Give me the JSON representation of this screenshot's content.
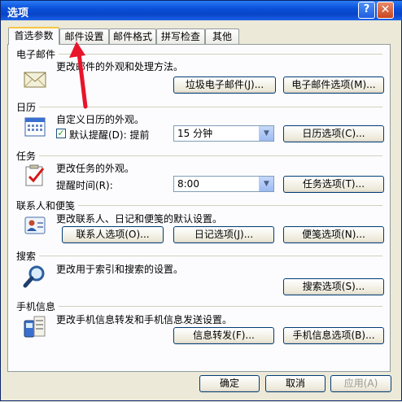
{
  "window": {
    "title": "选项",
    "help_label": "?",
    "close_label": "✕"
  },
  "tabs": [
    {
      "label": "首选参数"
    },
    {
      "label": "邮件设置"
    },
    {
      "label": "邮件格式"
    },
    {
      "label": "拼写检查"
    },
    {
      "label": "其他"
    }
  ],
  "email": {
    "heading": "电子邮件",
    "description": "更改邮件的外观和处理方法。",
    "junk_button": "垃圾电子邮件(J)...",
    "options_button": "电子邮件选项(M)...",
    "icon": "envelope-icon"
  },
  "calendar": {
    "heading": "日历",
    "description": "自定义日历的外观。",
    "reminder_checkbox_label": "默认提醒(D): 提前",
    "reminder_checked": true,
    "reminder_value": "15 分钟",
    "options_button": "日历选项(C)...",
    "icon": "calendar-icon"
  },
  "tasks": {
    "heading": "任务",
    "description": "更改任务的外观。",
    "reminder_time_label": "提醒时间(R):",
    "reminder_time_value": "8:00",
    "options_button": "任务选项(T)...",
    "icon": "task-check-icon"
  },
  "contacts": {
    "heading": "联系人和便笺",
    "description": "更改联系人、日记和便笺的默认设置。",
    "contact_button": "联系人选项(O)...",
    "journal_button": "日记选项(J)...",
    "notes_button": "便笺选项(N)...",
    "icon": "contact-card-icon"
  },
  "search": {
    "heading": "搜索",
    "description": "更改用于索引和搜索的设置。",
    "options_button": "搜索选项(S)...",
    "icon": "magnifier-icon"
  },
  "mobile": {
    "heading": "手机信息",
    "description": "更改手机信息转发和手机信息发送设置。",
    "forward_button": "信息转发(F)...",
    "options_button": "手机信息选项(B)...",
    "icon": "mobile-phone-icon"
  },
  "footer": {
    "ok": "确定",
    "cancel": "取消",
    "apply": "应用(A)"
  },
  "colors": {
    "title_bar": "#0a4fd8",
    "annotation_arrow": "#e8142a"
  }
}
